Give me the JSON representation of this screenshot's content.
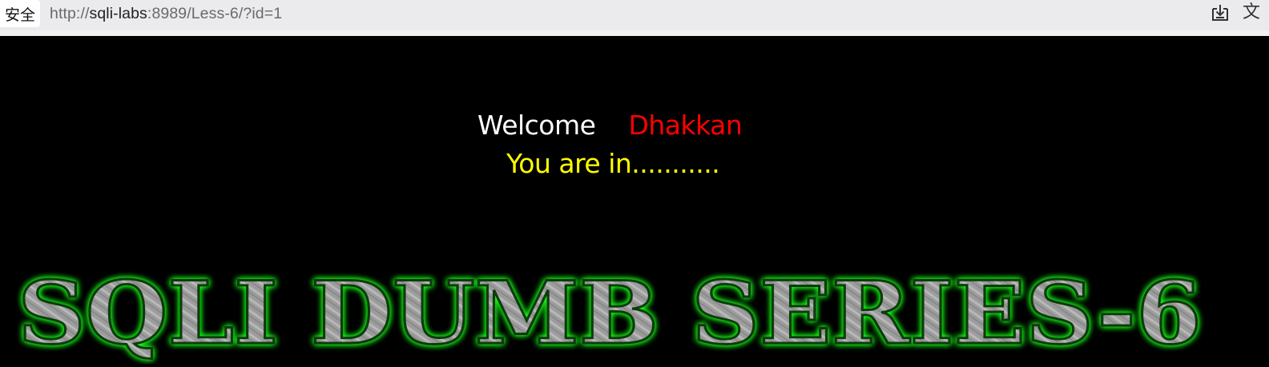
{
  "browser": {
    "security_label": "安全",
    "url_prefix": "http://",
    "url_host": "sqli-labs",
    "url_rest": ":8989/Less-6/?id=1",
    "translate_glyph": "文",
    "icons": {
      "download": "download-icon",
      "translate": "translate-icon"
    }
  },
  "page": {
    "welcome_word": "Welcome",
    "welcome_name": "Dhakkan",
    "status_text": "You are in...........",
    "banner_text": "SQLI DUMB SERIES-6"
  },
  "colors": {
    "background": "#000000",
    "welcome": "#ffffff",
    "name": "#ff0000",
    "status": "#ffff00",
    "banner_glow": "#19ff19",
    "banner_fill": "#a9a9a9"
  }
}
